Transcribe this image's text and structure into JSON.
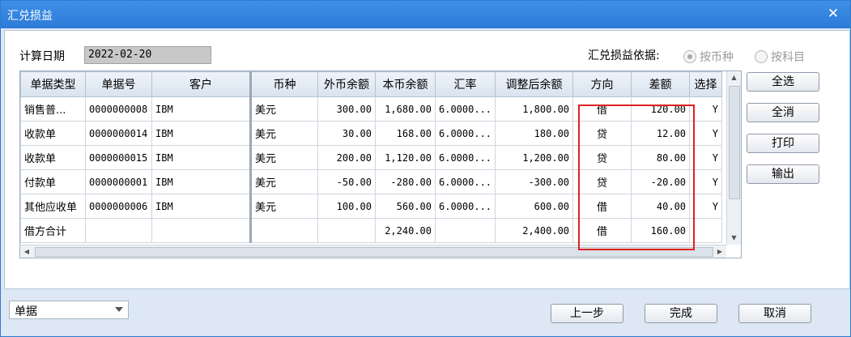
{
  "window": {
    "title": "汇兑损益",
    "close_glyph": "✕"
  },
  "filters": {
    "calc_date_label": "计算日期",
    "calc_date_value": "2022-02-20",
    "basis_label": "汇兑损益依据:",
    "basis_options": [
      {
        "label": "按币种",
        "selected": true
      },
      {
        "label": "按科目",
        "selected": false
      }
    ]
  },
  "table": {
    "columns": [
      "单据类型",
      "单据号",
      "客户",
      "币种",
      "外币余额",
      "本币余额",
      "汇率",
      "调整后余额",
      "方向",
      "差额",
      "选择"
    ],
    "rows": [
      [
        "销售普...",
        "0000000008",
        "IBM",
        "美元",
        "300.00",
        "1,680.00",
        "6.0000...",
        "1,800.00",
        "借",
        "120.00",
        "Y"
      ],
      [
        "收款单",
        "0000000014",
        "IBM",
        "美元",
        "30.00",
        "168.00",
        "6.0000...",
        "180.00",
        "贷",
        "12.00",
        "Y"
      ],
      [
        "收款单",
        "0000000015",
        "IBM",
        "美元",
        "200.00",
        "1,120.00",
        "6.0000...",
        "1,200.00",
        "贷",
        "80.00",
        "Y"
      ],
      [
        "付款单",
        "0000000001",
        "IBM",
        "美元",
        "-50.00",
        "-280.00",
        "6.0000...",
        "-300.00",
        "贷",
        "-20.00",
        "Y"
      ],
      [
        "其他应收单",
        "0000000006",
        "IBM",
        "美元",
        "100.00",
        "560.00",
        "6.0000...",
        "600.00",
        "借",
        "40.00",
        "Y"
      ]
    ],
    "total": [
      "借方合计",
      "",
      "",
      "",
      "",
      "2,240.00",
      "",
      "2,400.00",
      "借",
      "160.00",
      ""
    ]
  },
  "side_buttons": {
    "select_all": "全选",
    "clear_all": "全消",
    "print": "打印",
    "export": "输出"
  },
  "footer": {
    "view_select": "单据",
    "prev": "上一步",
    "finish": "完成",
    "cancel": "取消"
  },
  "colors": {
    "titlebar": "#2d7bd8",
    "highlight": "#e02020"
  }
}
